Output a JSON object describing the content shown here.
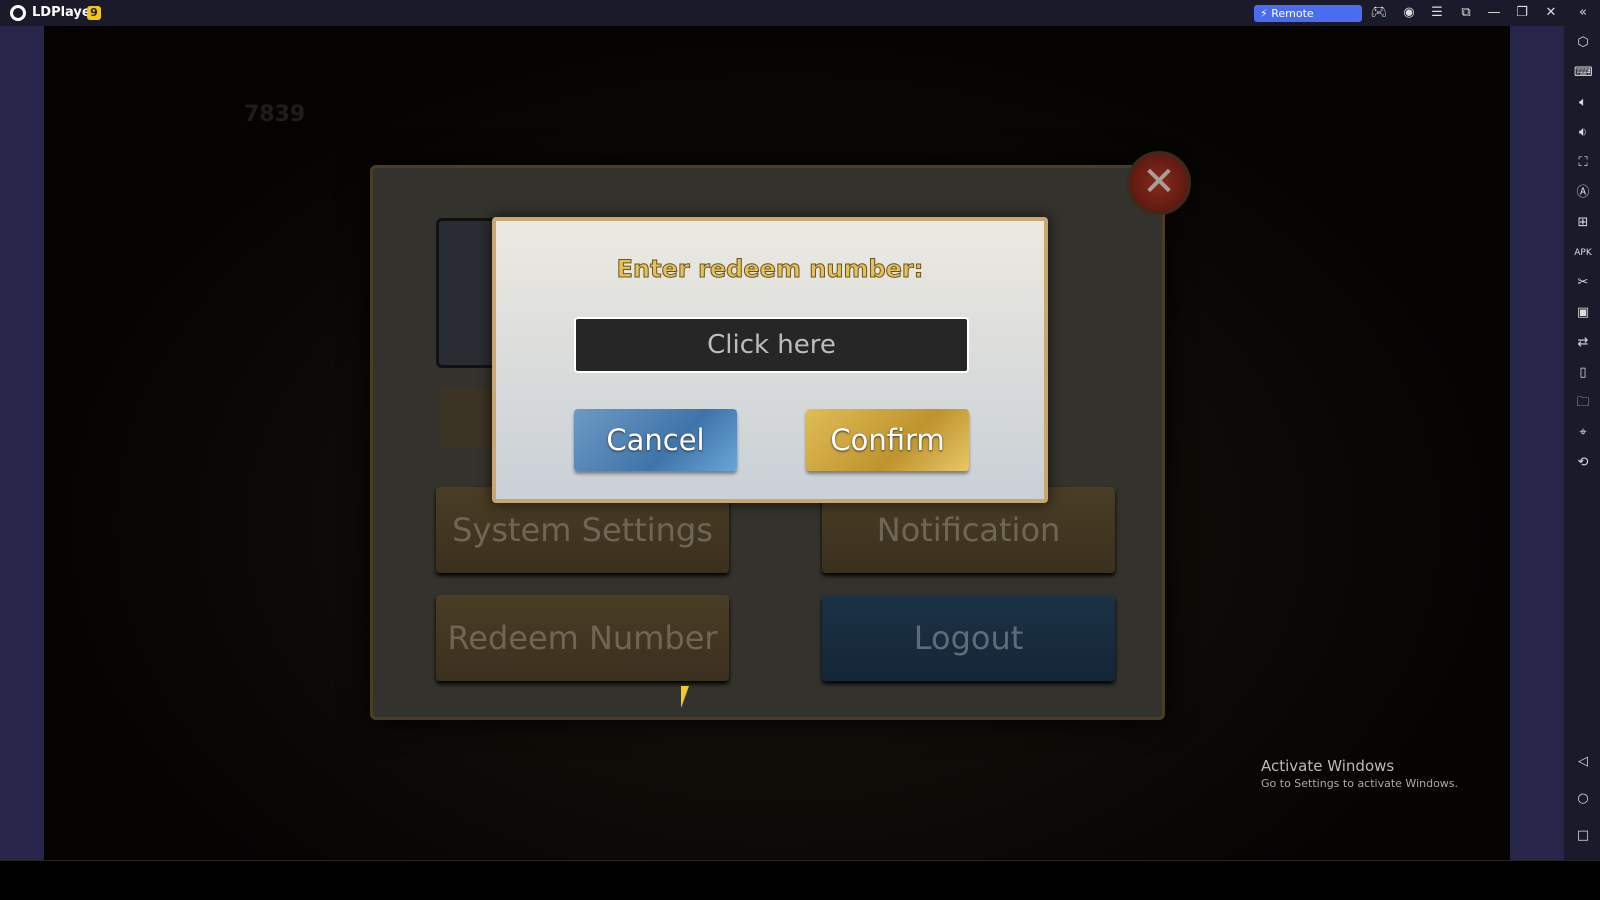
{
  "titlebar": {
    "app_name": "LDPlayer",
    "version": "9",
    "remote_label": "Remote LDPlayer",
    "icons": [
      "gamepad-icon",
      "account-icon",
      "menu-icon",
      "resize-icon",
      "minimize-icon",
      "restore-icon",
      "close-icon",
      "collapse-icon"
    ]
  },
  "sidebar": {
    "icons": [
      "settings-icon",
      "keyboard-icon",
      "volume-up-icon",
      "volume-down-icon",
      "fullscreen-icon",
      "auto-rotate-icon",
      "add-window-icon",
      "apk-icon",
      "scissors-icon",
      "record-icon",
      "sync-icon",
      "shake-icon",
      "folder-icon",
      "location-icon",
      "rotate-icon"
    ],
    "nav_icons": [
      "back-icon",
      "home-icon",
      "recents-icon"
    ]
  },
  "game": {
    "hud_value": "7839",
    "menu": {
      "system_settings": "System Settings",
      "notification": "Notification",
      "redeem_number": "Redeem Number",
      "logout": "Logout"
    },
    "dialog": {
      "title": "Enter redeem number:",
      "input_placeholder": "Click here",
      "cancel": "Cancel",
      "confirm": "Confirm"
    }
  },
  "watermark": {
    "title": "Activate Windows",
    "subtitle": "Go to Settings to activate Windows."
  },
  "colors": {
    "titlebar": "#1b1a2b",
    "strip": "#27264a",
    "remote_button": "#4a6cf0",
    "confirm": "#c9a23e",
    "cancel": "#4f83b8"
  }
}
